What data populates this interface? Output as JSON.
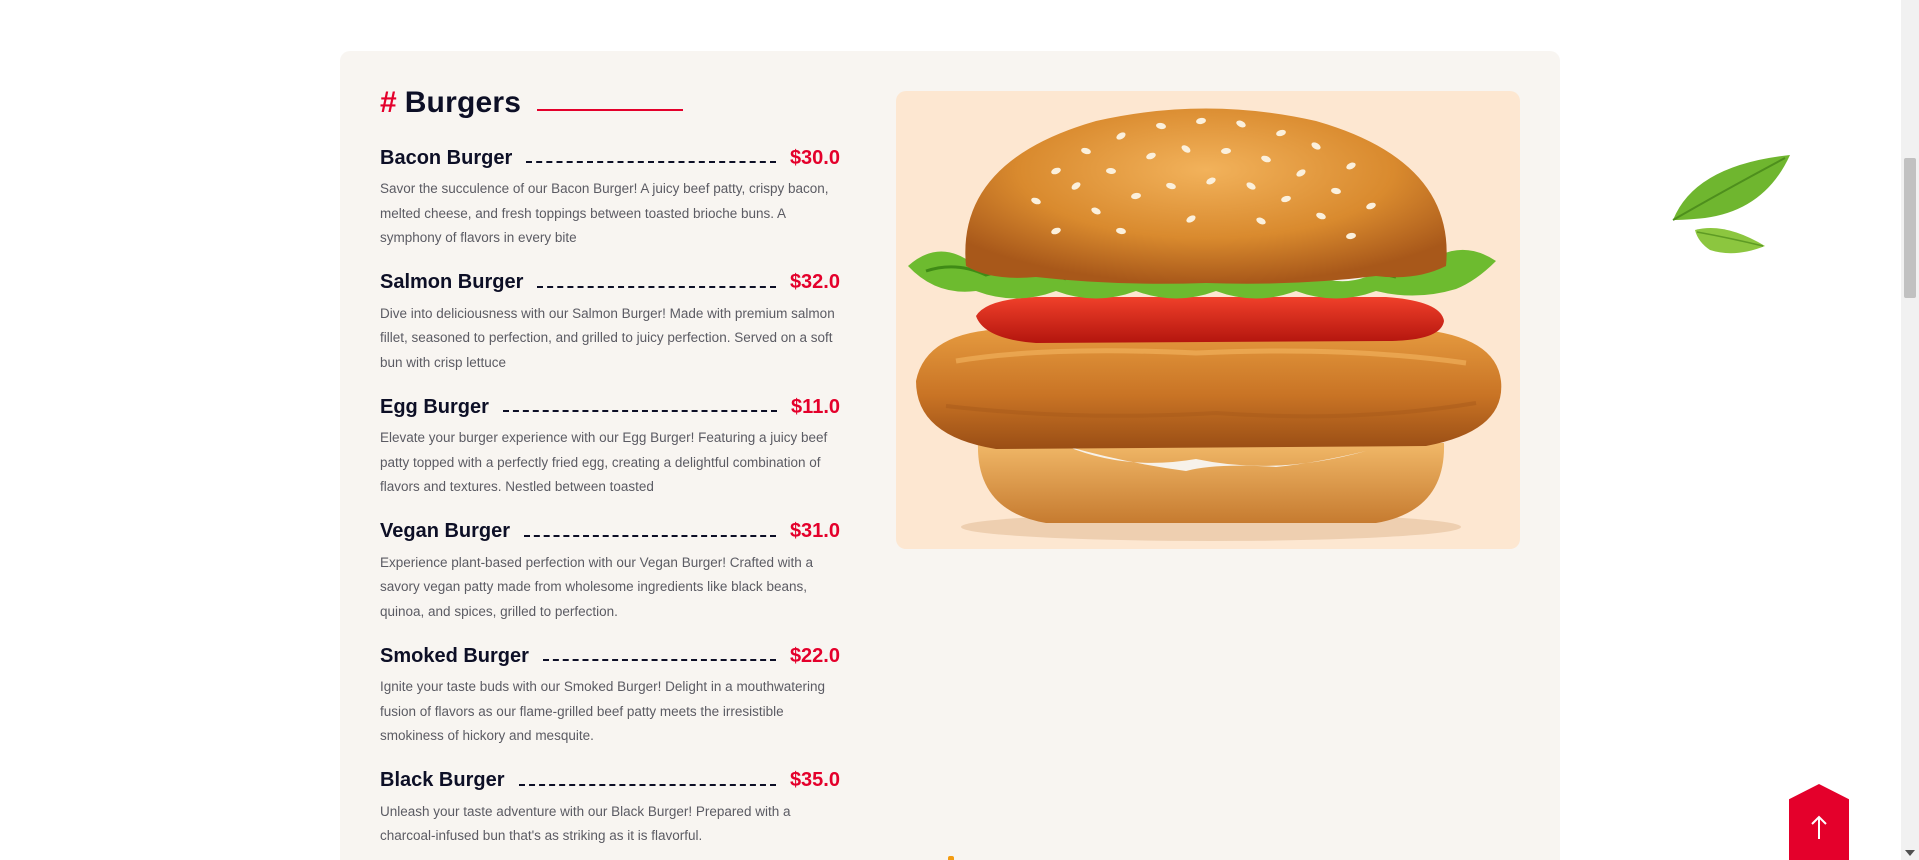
{
  "section": {
    "hash": "#",
    "title": "Burgers"
  },
  "menu_items": [
    {
      "name": "Bacon Burger",
      "price": "$30.0",
      "description": "Savor the succulence of our Bacon Burger! A juicy beef patty, crispy bacon, melted cheese, and fresh toppings between toasted brioche buns. A symphony of flavors in every bite"
    },
    {
      "name": "Salmon Burger",
      "price": "$32.0",
      "description": "Dive into deliciousness with our Salmon Burger! Made with premium salmon fillet, seasoned to perfection, and grilled to juicy perfection. Served on a soft bun with crisp lettuce"
    },
    {
      "name": "Egg Burger",
      "price": "$11.0",
      "description": "Elevate your burger experience with our Egg Burger! Featuring a juicy beef patty topped with a perfectly fried egg, creating a delightful combination of flavors and textures. Nestled between toasted"
    },
    {
      "name": "Vegan Burger",
      "price": "$31.0",
      "description": "Experience plant-based perfection with our Vegan Burger! Crafted with a savory vegan patty made from wholesome ingredients like black beans, quinoa, and spices, grilled to perfection."
    },
    {
      "name": "Smoked Burger",
      "price": "$22.0",
      "description": "Ignite your taste buds with our Smoked Burger! Delight in a mouthwatering fusion of flavors as our flame-grilled beef patty meets the irresistible smokiness of hickory and mesquite."
    },
    {
      "name": "Black Burger",
      "price": "$35.0",
      "description": "Unleash your taste adventure with our Black Burger! Prepared with a charcoal-infused bun that's as striking as it is flavorful."
    }
  ],
  "colors": {
    "accent": "#e4002b",
    "heading": "#0d0f26",
    "body_text": "#5b5b63",
    "card_bg": "#f8f5f1",
    "image_bg": "#fde7d1"
  },
  "icons": {
    "scroll_top": "arrow-up-icon",
    "decoration": "leaf-icon",
    "image": "burger-image"
  }
}
